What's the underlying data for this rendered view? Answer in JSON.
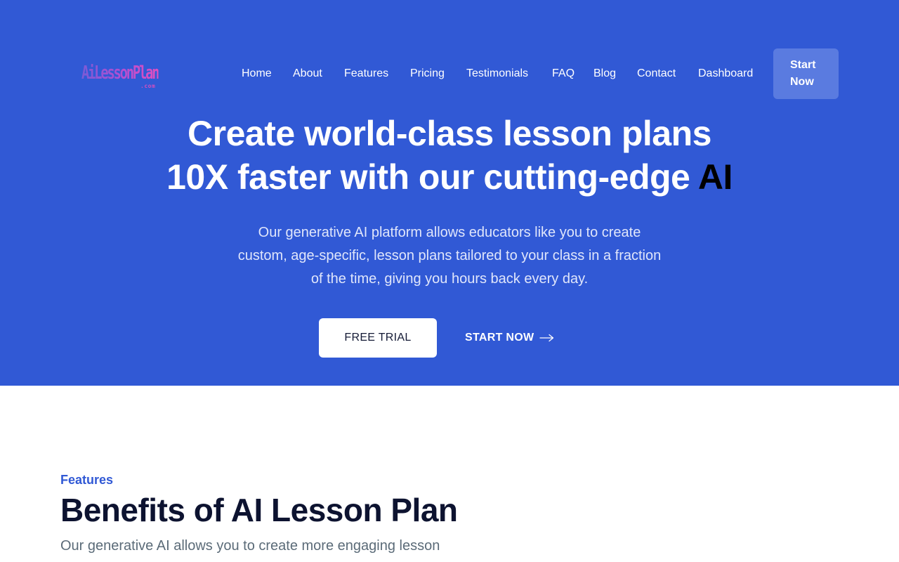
{
  "header": {
    "logo": {
      "text": "AiLessonPlan",
      "sub": ".com"
    },
    "nav": [
      {
        "label": "Home"
      },
      {
        "label": "About"
      },
      {
        "label": "Features"
      },
      {
        "label": "Pricing"
      },
      {
        "label": "Testimonials"
      },
      {
        "label": "FAQ"
      },
      {
        "label": "Blog"
      },
      {
        "label": "Contact"
      },
      {
        "label": "Dashboard"
      }
    ],
    "cta_label_line1": "Start",
    "cta_label_line2": "Now"
  },
  "hero": {
    "headline_line1": "Create world-class lesson plans",
    "headline_line2_main": "10X faster with our cutting-edge ",
    "headline_line2_accent": "AI",
    "subtitle": "Our generative AI platform allows educators like you to create custom, age-specific, lesson plans tailored to your class in a fraction of the time, giving you hours back every day.",
    "primary_button": "FREE TRIAL",
    "secondary_link": "START NOW",
    "secondary_icon": "arrow-right-icon"
  },
  "features": {
    "eyebrow": "Features",
    "title": "Benefits of AI Lesson Plan",
    "subtitle": "Our generative AI allows you to create more engaging lesson"
  },
  "colors": {
    "hero_bg": "#3159d5",
    "button_bg": "#5a7be0",
    "accent": "#3159d5",
    "title_text": "#0d1330"
  }
}
